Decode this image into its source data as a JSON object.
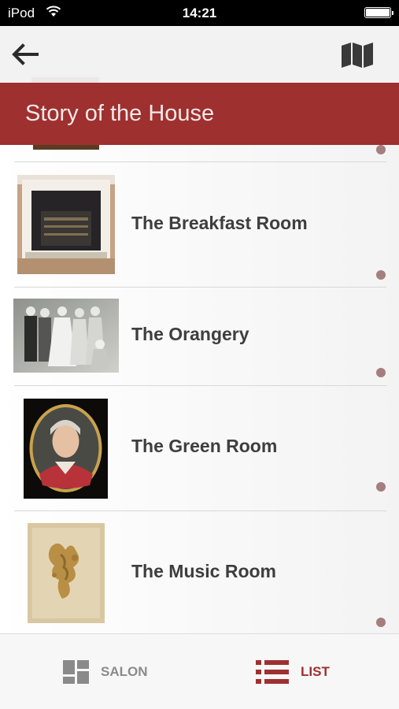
{
  "status_bar": {
    "carrier": "iPod",
    "time": "14:21"
  },
  "nav": {
    "back_icon": "arrow-left-icon",
    "map_icon": "map-icon"
  },
  "header": {
    "title": "Story of the House"
  },
  "rooms": [
    {
      "label": "The Breakfast Room"
    },
    {
      "label": "The Orangery"
    },
    {
      "label": "The Green Room"
    },
    {
      "label": "The Music Room"
    }
  ],
  "tabs": [
    {
      "label": "SALON",
      "icon": "grid-icon",
      "active": false
    },
    {
      "label": "LIST",
      "icon": "list-icon",
      "active": true
    }
  ],
  "colors": {
    "accent": "#9e3030",
    "header_text": "#f7e7e7",
    "room_text": "#3e3e3e",
    "dot": "#a57e7e",
    "tab_inactive": "#8a8a8a"
  }
}
